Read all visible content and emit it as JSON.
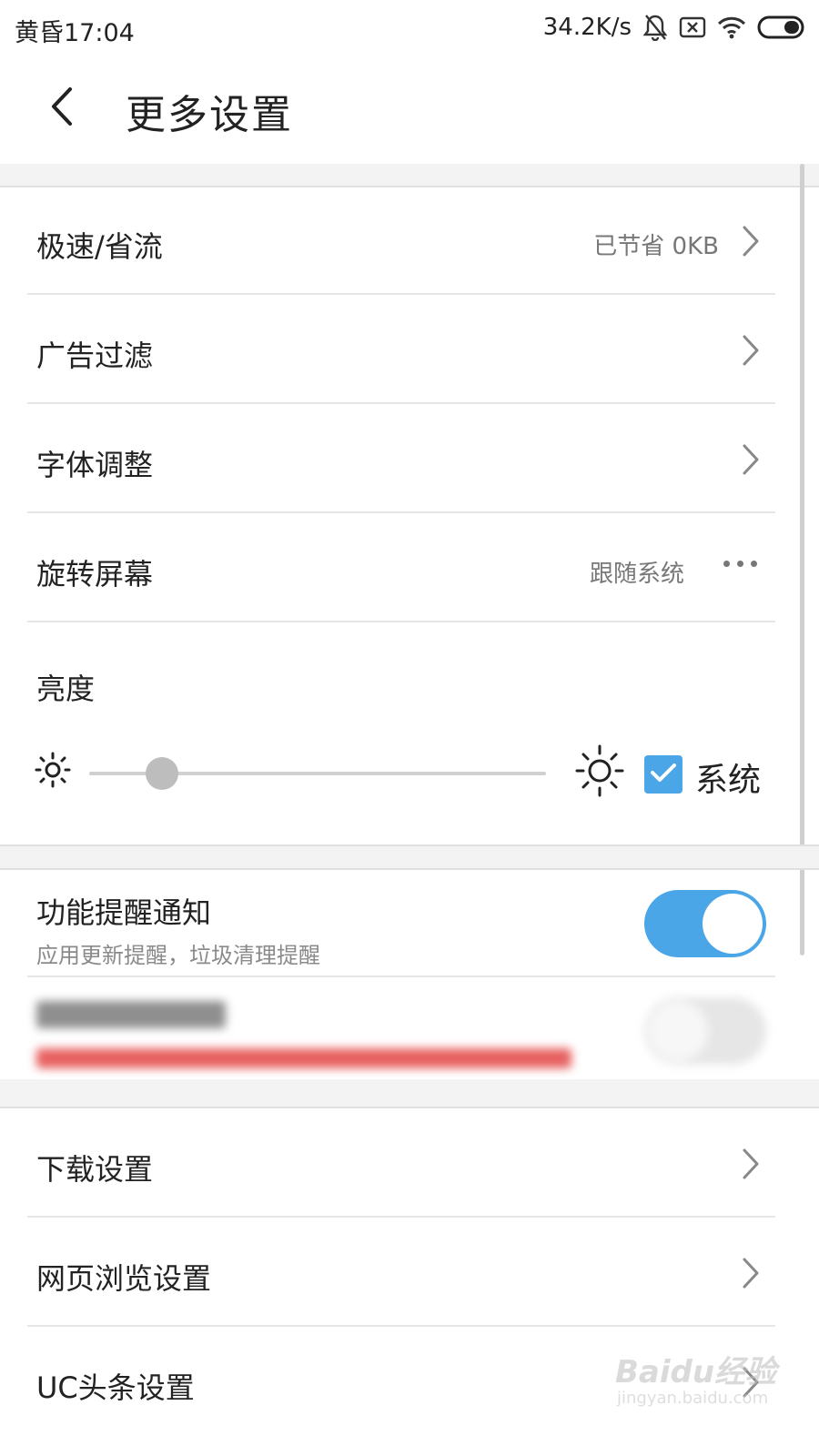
{
  "status_bar": {
    "time": "黄昏17:04",
    "net_speed": "34.2K/s",
    "icons": [
      "mute-bell-icon",
      "sim-error-icon",
      "wifi-icon",
      "battery-icon"
    ]
  },
  "header": {
    "back_icon": "chevron-left-icon",
    "title": "更多设置"
  },
  "settings_group_1": [
    {
      "label": "极速/省流",
      "value": "已节省 0KB",
      "accessory": "chevron-right-icon"
    },
    {
      "label": "广告过滤",
      "value": "",
      "accessory": "chevron-right-icon"
    },
    {
      "label": "字体调整",
      "value": "",
      "accessory": "chevron-right-icon"
    },
    {
      "label": "旋转屏幕",
      "value": "跟随系统",
      "accessory": "more-dots-icon"
    }
  ],
  "brightness": {
    "label": "亮度",
    "level": 0.16,
    "follow_system_checked": true,
    "follow_system_label": "系统"
  },
  "notifications": {
    "feature_reminder": {
      "label": "功能提醒通知",
      "subtitle": "应用更新提醒，垃圾清理提醒",
      "enabled": true
    },
    "blurred_item": {
      "enabled": false
    }
  },
  "settings_group_2": [
    {
      "label": "下载设置",
      "accessory": "chevron-right-icon"
    },
    {
      "label": "网页浏览设置",
      "accessory": "chevron-right-icon"
    },
    {
      "label": "UC头条设置",
      "accessory": "chevron-right-icon"
    }
  ],
  "watermark": {
    "brand": "Baidu经验",
    "url": "jingyan.baidu.com"
  },
  "colors": {
    "accent": "#4aa6e6",
    "blur_subtitle": "#e13a3a"
  }
}
